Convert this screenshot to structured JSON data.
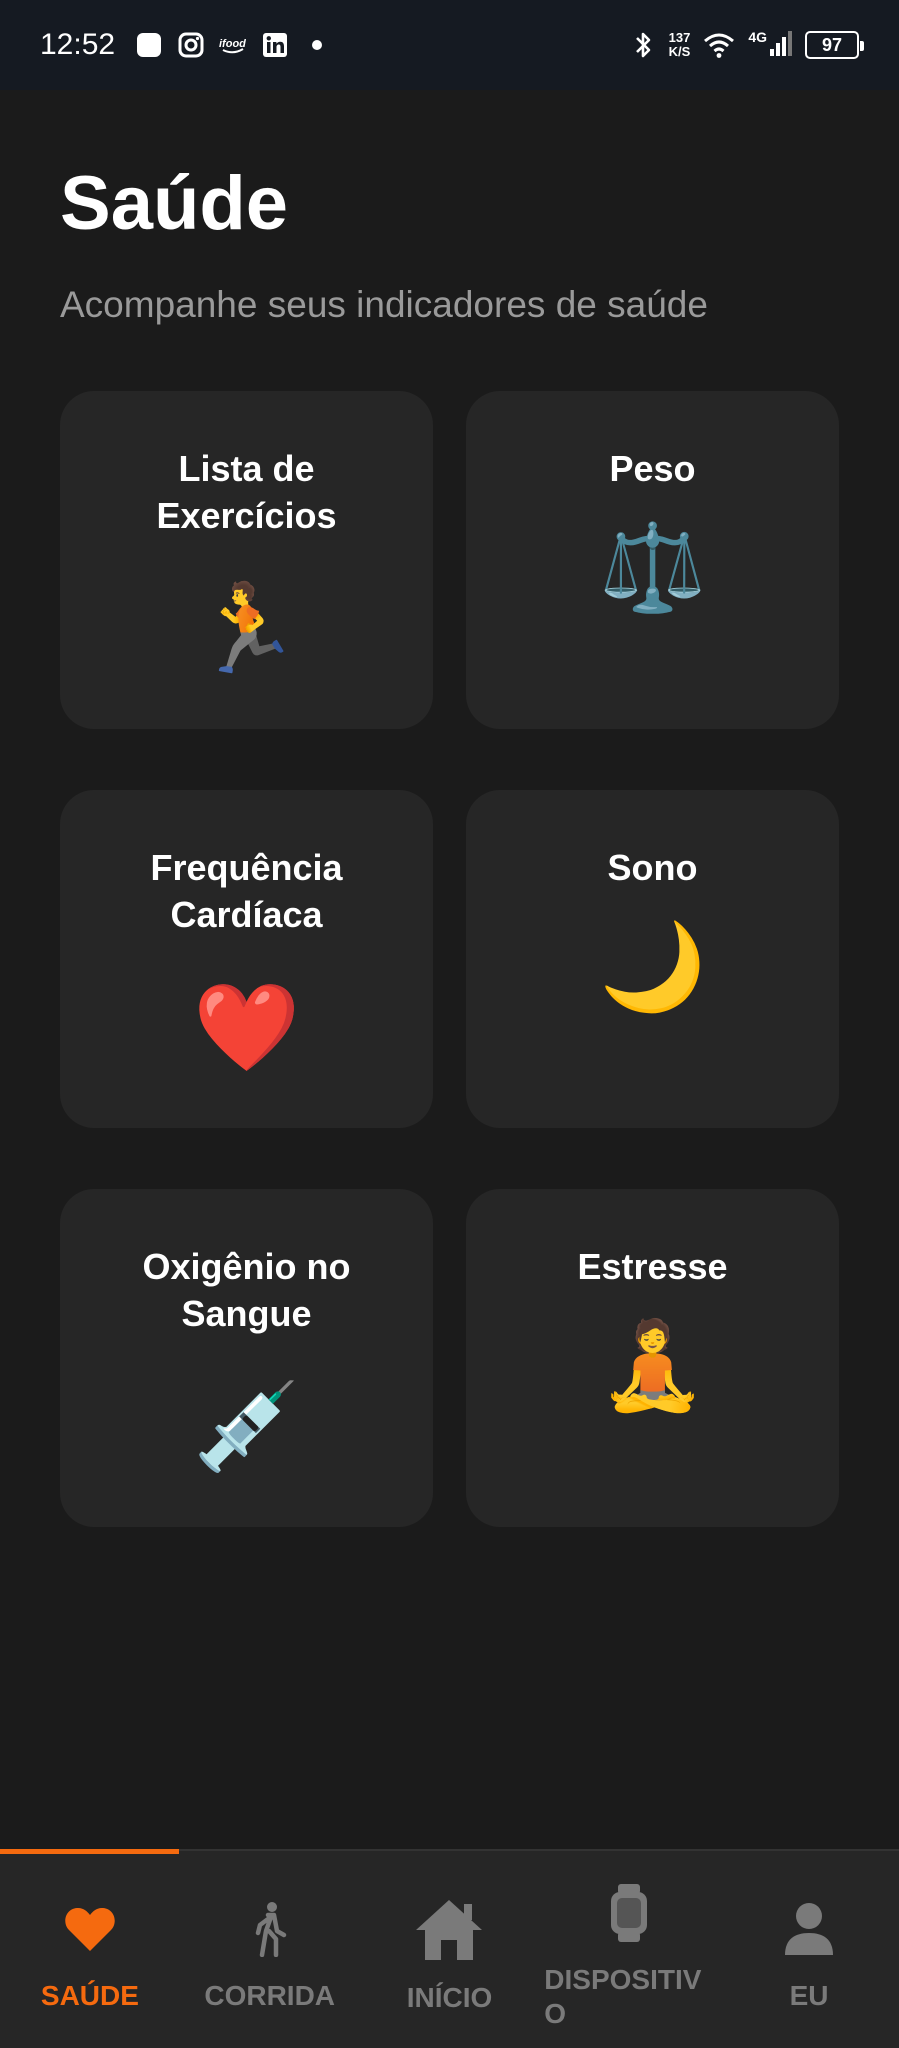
{
  "status_bar": {
    "time": "12:52",
    "left_icons": [
      "app-square-icon",
      "instagram-icon",
      "ifood-icon",
      "linkedin-icon",
      "dot-icon"
    ],
    "speed_value": "137",
    "speed_unit": "K/S",
    "network": "4G",
    "battery": "97"
  },
  "header": {
    "title": "Saúde",
    "subtitle": "Acompanhe seus indicadores de saúde"
  },
  "cards": [
    {
      "title": "Lista de Exercícios",
      "emoji": "🏃",
      "icon": "runner-icon"
    },
    {
      "title": "Peso",
      "emoji": "⚖️",
      "icon": "scale-icon"
    },
    {
      "title": "Frequência Cardíaca",
      "emoji": "❤️",
      "icon": "heart-icon"
    },
    {
      "title": "Sono",
      "emoji": "🌙",
      "icon": "moon-icon"
    },
    {
      "title": "Oxigênio no Sangue",
      "emoji": "💉",
      "icon": "syringe-icon"
    },
    {
      "title": "Estresse",
      "emoji": "🧘",
      "icon": "meditation-icon"
    }
  ],
  "bottom_nav": {
    "active_color": "#f56a0f",
    "inactive_color": "#7a7a7a",
    "items": [
      {
        "label": "SAÚDE",
        "icon": "heart-icon",
        "active": true
      },
      {
        "label": "CORRIDA",
        "icon": "walking-icon",
        "active": false
      },
      {
        "label": "INÍCIO",
        "icon": "home-icon",
        "active": false
      },
      {
        "label": "DISPOSITIVO",
        "icon": "watch-icon",
        "active": false
      },
      {
        "label": "EU",
        "icon": "person-icon",
        "active": false
      }
    ]
  }
}
